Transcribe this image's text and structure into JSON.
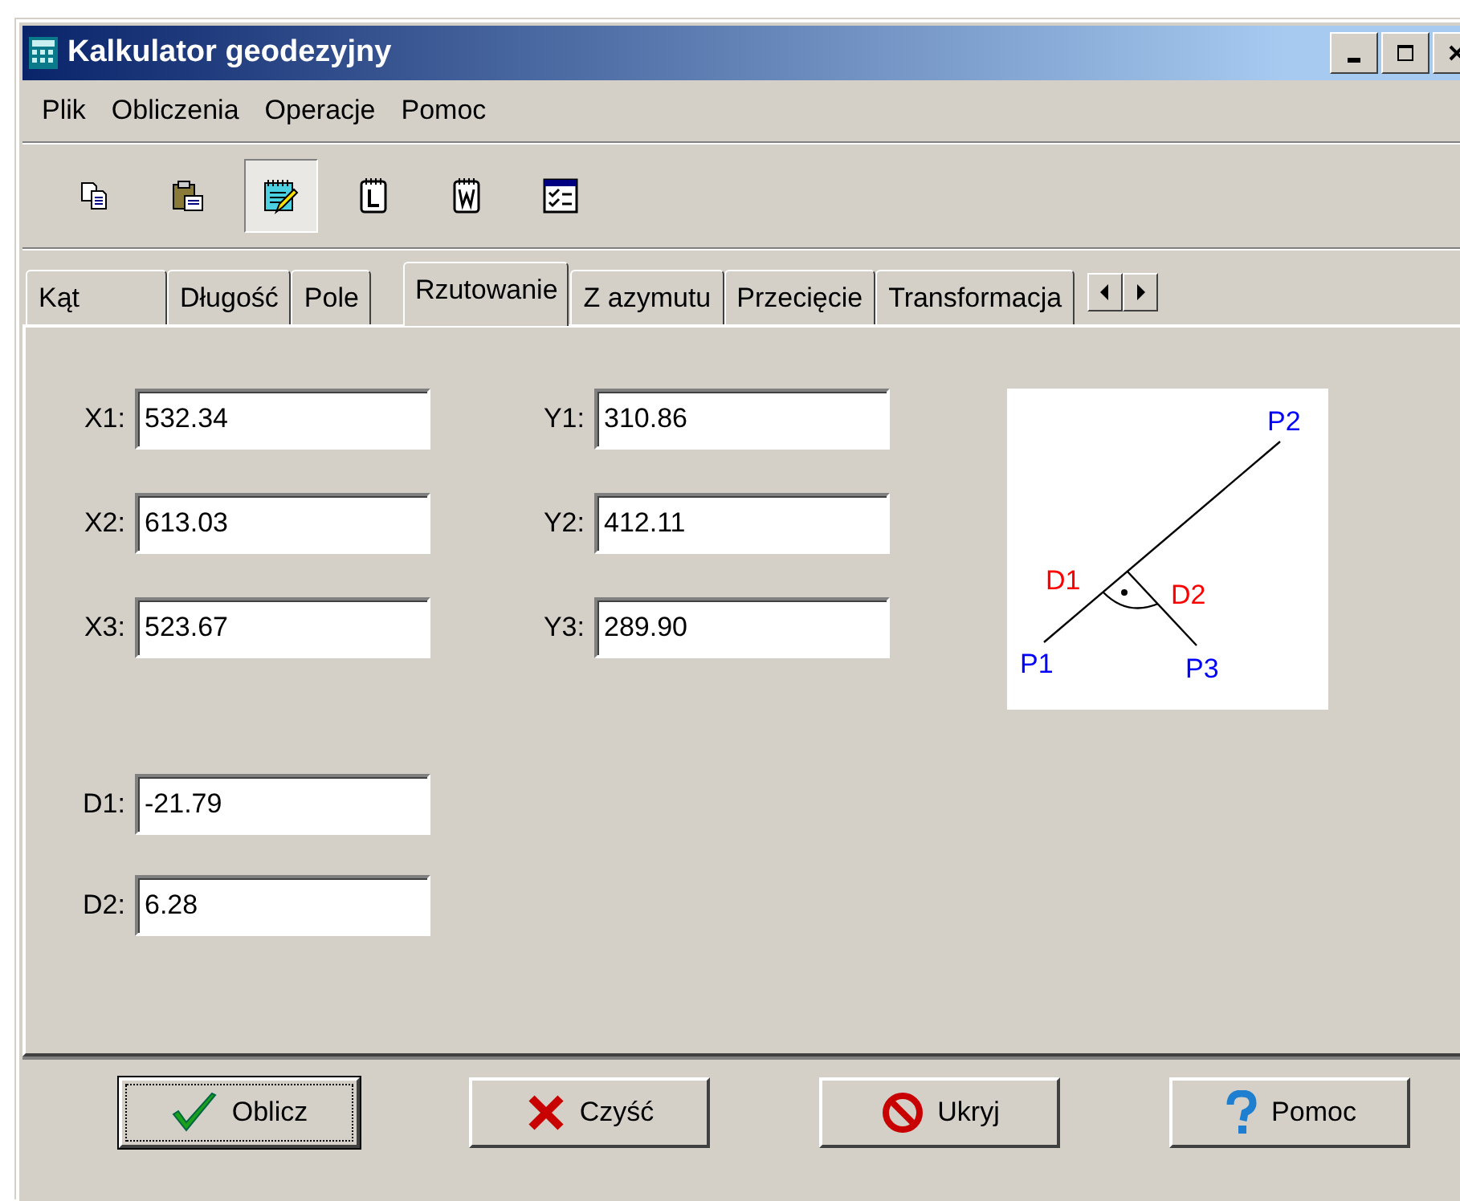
{
  "window": {
    "title": "Kalkulator geodezyjny"
  },
  "menu": [
    {
      "label": "Plik"
    },
    {
      "label": "Obliczenia"
    },
    {
      "label": "Operacje"
    },
    {
      "label": "Pomoc"
    }
  ],
  "toolbar": [
    {
      "kind": "copy",
      "selected": false
    },
    {
      "kind": "paste",
      "selected": false
    },
    {
      "kind": "notepad",
      "selected": true
    },
    {
      "kind": "doc-l",
      "selected": false
    },
    {
      "kind": "doc-w",
      "selected": false
    },
    {
      "kind": "checklist",
      "selected": false
    }
  ],
  "tabs": [
    {
      "label": "Kąt",
      "selected": false
    },
    {
      "label": "Długość",
      "selected": false
    },
    {
      "label": "Pole",
      "selected": false
    },
    {
      "label": "Rzutowanie",
      "selected": true
    },
    {
      "label": "Z azymutu",
      "selected": false
    },
    {
      "label": "Przecięcie",
      "selected": false
    },
    {
      "label": "Transformacja",
      "selected": false
    }
  ],
  "fields_left": [
    {
      "label": "X1:",
      "value": "532.34"
    },
    {
      "label": "X2:",
      "value": "613.03"
    },
    {
      "label": "X3:",
      "value": "523.67"
    }
  ],
  "fields_right": [
    {
      "label": "Y1:",
      "value": "310.86"
    },
    {
      "label": "Y2:",
      "value": "412.11"
    },
    {
      "label": "Y3:",
      "value": "289.90"
    }
  ],
  "results": [
    {
      "label": "D1:",
      "value": "-21.79"
    },
    {
      "label": "D2:",
      "value": "6.28"
    }
  ],
  "diagram": {
    "labels": [
      {
        "text": "P2",
        "color": "#0000ff"
      },
      {
        "text": "D1",
        "color": "#ff0000"
      },
      {
        "text": "D2",
        "color": "#ff0000"
      },
      {
        "text": "P1",
        "color": "#0000ff"
      },
      {
        "text": "P3",
        "color": "#0000ff"
      }
    ]
  },
  "buttons": [
    {
      "label": "Oblicz",
      "kind": "check",
      "default": true
    },
    {
      "label": "Czyść",
      "kind": "cross",
      "default": false
    },
    {
      "label": "Ukryj",
      "kind": "forbidden",
      "default": false
    },
    {
      "label": "Pomoc",
      "kind": "help",
      "default": false
    }
  ]
}
